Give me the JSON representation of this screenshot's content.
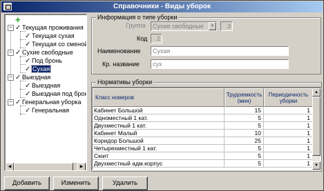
{
  "window": {
    "title": "Справочники - Виды уборок"
  },
  "tree": {
    "nodes": [
      {
        "label": "Текущая проживания",
        "level": 0
      },
      {
        "label": "Текущая сухая",
        "level": 1
      },
      {
        "label": "Текущая со сменой",
        "level": 1
      },
      {
        "label": "Сухие свободные",
        "level": 0
      },
      {
        "label": "Под бронь",
        "level": 1
      },
      {
        "label": "Сухая",
        "level": 1,
        "selected": true
      },
      {
        "label": "Выездная",
        "level": 0
      },
      {
        "label": "Выездная",
        "level": 1
      },
      {
        "label": "Выездная под бронь",
        "level": 1
      },
      {
        "label": "Генеральная уборка",
        "level": 0
      },
      {
        "label": "Генеральная",
        "level": 1
      }
    ]
  },
  "info": {
    "title": "Информация о типе уборки",
    "group_label": "Группа",
    "group_value": "Сухие свободные",
    "group_id": "3",
    "code_label": "Код",
    "code_value": "2",
    "name_label": "Наименование",
    "name_value": "Сухая",
    "short_label": "Кр. название",
    "short_value": "сух"
  },
  "norms": {
    "title": "Нормативы уборки",
    "columns": [
      "Класс номеров",
      "Трудоемкость (мин)",
      "Периодичность уборки"
    ],
    "rows": [
      [
        "Кабинет Большой",
        "15",
        "1"
      ],
      [
        "Одноместный 1 кат.",
        "5",
        "1"
      ],
      [
        "Двухместный 1 кат.",
        "5",
        "1"
      ],
      [
        "Кабинет Малый",
        "10",
        "1"
      ],
      [
        "Коридор Большой",
        "25",
        "1"
      ],
      [
        "Четырехместный 1 кат.",
        "5",
        "1"
      ],
      [
        "Сюит",
        "5",
        "1"
      ],
      [
        "Двухместный адм.корпус",
        "5",
        "1"
      ]
    ]
  },
  "buttons": {
    "add": "Добавить",
    "edit": "Изменить",
    "delete": "Удалить"
  },
  "colors": {
    "titlebar": "#0a246a",
    "face": "#d4d0c8",
    "selection": "#0a246a",
    "plus": "#1c9c1c"
  }
}
